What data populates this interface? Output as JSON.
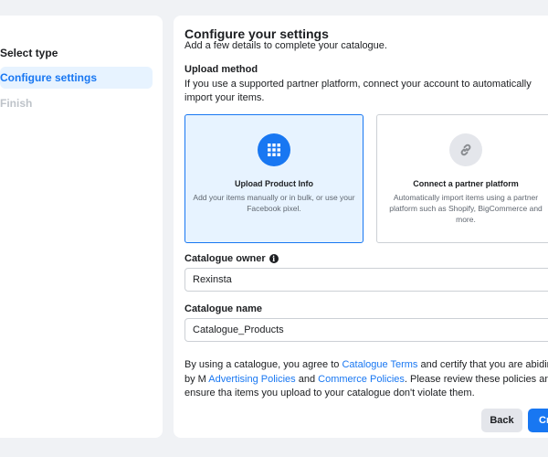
{
  "steps": [
    {
      "label": "Select type",
      "state": "done"
    },
    {
      "label": "Configure settings",
      "state": "active"
    },
    {
      "label": "Finish",
      "state": "disabled"
    }
  ],
  "main": {
    "title": "Configure your settings",
    "subtitle": "Add a few details to complete your catalogue.",
    "upload_method_label": "Upload method",
    "upload_method_desc": "If you use a supported partner platform, connect your account to automatically import your items.",
    "cards": [
      {
        "icon": "grid-icon",
        "title": "Upload Product Info",
        "desc": "Add your items manually or in bulk, or use your Facebook pixel.",
        "selected": true
      },
      {
        "icon": "link-icon",
        "title": "Connect a partner platform",
        "desc": "Automatically import items using a partner platform such as Shopify, BigCommerce and more.",
        "selected": false
      }
    ],
    "owner_label": "Catalogue owner",
    "owner_value": "Rexinsta",
    "name_label": "Catalogue name",
    "name_value": "Catalogue_Products",
    "terms": {
      "part1": "By using a catalogue, you agree to ",
      "link1": "Catalogue Terms",
      "part2": " and certify that you are abiding by M",
      "link2": "Advertising Policies",
      "part3": " and ",
      "link3": "Commerce Policies",
      "part4": ". Please review these policies and ensure tha items you upload to your catalogue don't violate them."
    },
    "back_label": "Back",
    "create_label": "Cr"
  },
  "colors": {
    "accent": "#1877f2",
    "selected_bg": "#e7f3ff",
    "page_bg": "#f0f2f5"
  }
}
